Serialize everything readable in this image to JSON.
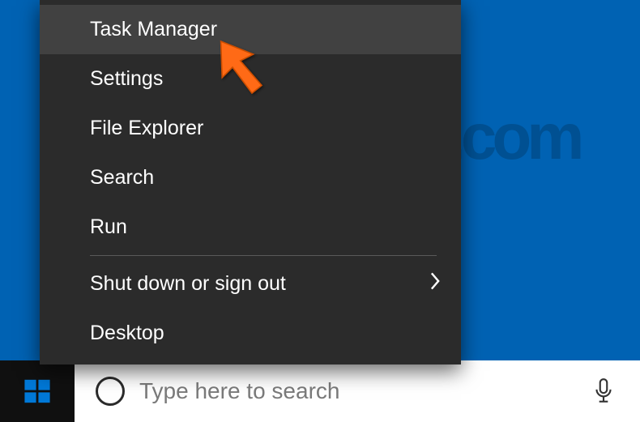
{
  "watermark_text": "PCrisk.com",
  "context_menu": {
    "items": [
      {
        "label": "Task Manager",
        "hovered": true
      },
      {
        "label": "Settings"
      },
      {
        "label": "File Explorer"
      },
      {
        "label": "Search"
      },
      {
        "label": "Run"
      }
    ],
    "separator": true,
    "items_after": [
      {
        "label": "Shut down or sign out",
        "has_submenu": true
      },
      {
        "label": "Desktop"
      }
    ]
  },
  "taskbar": {
    "search_placeholder": "Type here to search"
  },
  "colors": {
    "desktop_bg": "#0062b3",
    "menu_bg": "#2b2b2b",
    "menu_hover": "#414141",
    "taskbar_bg": "#101010",
    "start_blue": "#0078d7",
    "pointer_orange": "#ff6a13"
  }
}
